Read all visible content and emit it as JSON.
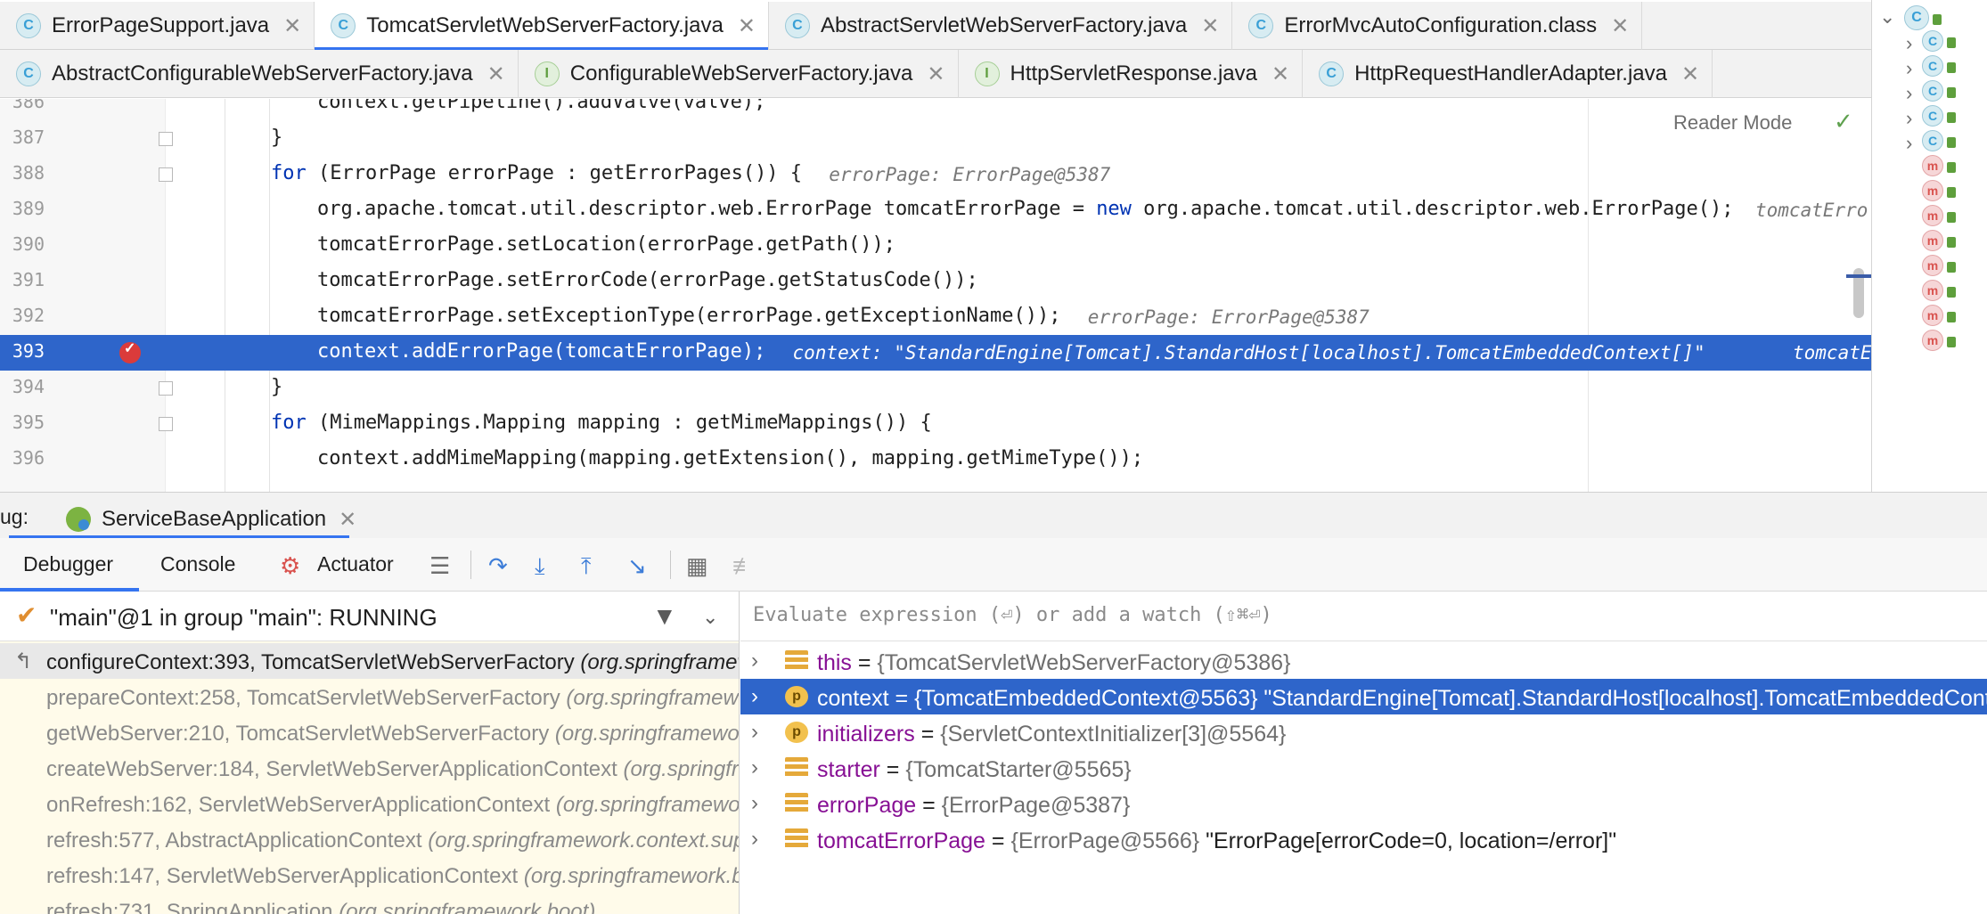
{
  "tabs_row1": [
    {
      "label": "ErrorPageSupport.java",
      "icon": "class-icon",
      "active": false
    },
    {
      "label": "TomcatServletWebServerFactory.java",
      "icon": "class-icon",
      "active": true
    },
    {
      "label": "AbstractServletWebServerFactory.java",
      "icon": "class-icon",
      "active": false
    },
    {
      "label": "ErrorMvcAutoConfiguration.class",
      "icon": "class-icon",
      "active": false
    }
  ],
  "tabs_row2": [
    {
      "label": "AbstractConfigurableWebServerFactory.java",
      "icon": "class-icon"
    },
    {
      "label": "ConfigurableWebServerFactory.java",
      "icon": "interface-icon"
    },
    {
      "label": "HttpServletResponse.java",
      "icon": "interface-icon"
    },
    {
      "label": "HttpRequestHandlerAdapter.java",
      "icon": "class-icon"
    }
  ],
  "icon_letters": {
    "class": "C",
    "interface": "I",
    "method": "m",
    "param": "p"
  },
  "close_glyph": "✕",
  "editor": {
    "reader_mode": "Reader Mode",
    "lines": [
      {
        "n": "386",
        "indent": 2,
        "code": "context.getPipeline().addValve(valve);",
        "hint": ""
      },
      {
        "n": "387",
        "indent": 1,
        "code": "}",
        "hint": ""
      },
      {
        "n": "388",
        "indent": 1,
        "kw": "for",
        "code": " (ErrorPage errorPage : getErrorPages()) {",
        "hint": "errorPage: ErrorPage@5387"
      },
      {
        "n": "389",
        "indent": 2,
        "code": "org.apache.tomcat.util.descriptor.web.ErrorPage tomcatErrorPage = ",
        "kw2": "new",
        "code2": " org.apache.tomcat.util.descriptor.web.ErrorPage();",
        "hint": "tomcatErro"
      },
      {
        "n": "390",
        "indent": 2,
        "code": "tomcatErrorPage.setLocation(errorPage.getPath());",
        "hint": ""
      },
      {
        "n": "391",
        "indent": 2,
        "code": "tomcatErrorPage.setErrorCode(errorPage.getStatusCode());",
        "hint": ""
      },
      {
        "n": "392",
        "indent": 2,
        "code": "tomcatErrorPage.setExceptionType(errorPage.getExceptionName());",
        "hint": "errorPage: ErrorPage@5387"
      },
      {
        "n": "393",
        "indent": 2,
        "code": "context.addErrorPage(tomcatErrorPage);",
        "hint": "context: \"StandardEngine[Tomcat].StandardHost[localhost].TomcatEmbeddedContext[]\"",
        "hint2": "tomcatE",
        "exec": true
      },
      {
        "n": "394",
        "indent": 1,
        "code": "}",
        "hint": ""
      },
      {
        "n": "395",
        "indent": 1,
        "kw": "for",
        "code": " (MimeMappings.Mapping mapping : getMimeMappings()) {",
        "hint": ""
      },
      {
        "n": "396",
        "indent": 2,
        "code": "context.addMimeMapping(mapping.getExtension(), mapping.getMimeType());",
        "hint": ""
      }
    ]
  },
  "debug": {
    "label": "ug:",
    "run_config": "ServiceBaseApplication",
    "tabs": {
      "debugger": "Debugger",
      "console": "Console",
      "actuator": "Actuator"
    },
    "thread": "\"main\"@1 in group \"main\": RUNNING",
    "frames": [
      {
        "method": "configureContext:393, TomcatServletWebServerFactory",
        "pkg": "(org.springframework.boot.web.embedded.tomcat)",
        "current": true
      },
      {
        "method": "prepareContext:258, TomcatServletWebServerFactory",
        "pkg": "(org.springframework.boot.web.embedded.tomcat)"
      },
      {
        "method": "getWebServer:210, TomcatServletWebServerFactory",
        "pkg": "(org.springframework.boot.web.embedded.tomcat)"
      },
      {
        "method": "createWebServer:184, ServletWebServerApplicationContext",
        "pkg": "(org.springframework.boot.web.servlet.context)"
      },
      {
        "method": "onRefresh:162, ServletWebServerApplicationContext",
        "pkg": "(org.springframework.boot.web.servlet.context)"
      },
      {
        "method": "refresh:577, AbstractApplicationContext",
        "pkg": "(org.springframework.context.support)"
      },
      {
        "method": "refresh:147, ServletWebServerApplicationContext",
        "pkg": "(org.springframework.boot.web.servlet.context)"
      },
      {
        "method": "refresh:731, SpringApplication",
        "pkg": "(org.springframework.boot)"
      }
    ],
    "eval_placeholder": "Evaluate expression (⏎) or add a watch (⇧⌘⏎)",
    "variables": [
      {
        "name": "this",
        "value": "{TomcatServletWebServerFactory@5386}",
        "str": "",
        "kind": "field"
      },
      {
        "name": "context",
        "value": "{TomcatEmbeddedContext@5563}",
        "str": "\"StandardEngine[Tomcat].StandardHost[localhost].TomcatEmbeddedContext[]\"",
        "kind": "param",
        "selected": true
      },
      {
        "name": "initializers",
        "value": "{ServletContextInitializer[3]@5564}",
        "str": "",
        "kind": "param"
      },
      {
        "name": "starter",
        "value": "{TomcatStarter@5565}",
        "str": "",
        "kind": "field"
      },
      {
        "name": "errorPage",
        "value": "{ErrorPage@5387}",
        "str": "",
        "kind": "field"
      },
      {
        "name": "tomcatErrorPage",
        "value": "{ErrorPage@5566}",
        "str": "\"ErrorPage[errorCode=0, location=/error]\"",
        "kind": "field"
      }
    ]
  },
  "structure_items": [
    "class",
    "class",
    "class",
    "class",
    "class",
    "method",
    "method",
    "method",
    "method",
    "method",
    "method",
    "method",
    "method"
  ]
}
